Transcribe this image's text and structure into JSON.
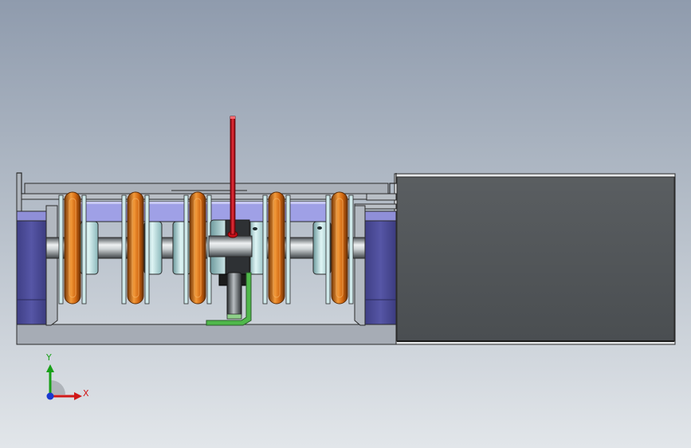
{
  "triad": {
    "x_label": "X",
    "y_label": "Y",
    "x_color": "#d01818",
    "y_color": "#18a018",
    "z_color": "#1838d0"
  },
  "colors": {
    "frame_outline": "#2a2a2a",
    "frame_face": "#a9afb8",
    "frame_inner": "#c7ccd3",
    "motor_body": "#53575a",
    "motor_edge": "#e8e8e8",
    "bearing_block": "#4f4f9a",
    "bearing_light": "#8f8fd8",
    "shaft_light": "#e3e6e8",
    "shaft_dark": "#5b6064",
    "disc_light": "#d8f0f0",
    "disc_dark": "#7aa8ac",
    "ring_orange": "#e07a1a",
    "ring_dark": "#7a3a08",
    "rod_red": "#c8101a",
    "bracket_green": "#4fb84a",
    "block_dark": "#1c1c1c"
  }
}
